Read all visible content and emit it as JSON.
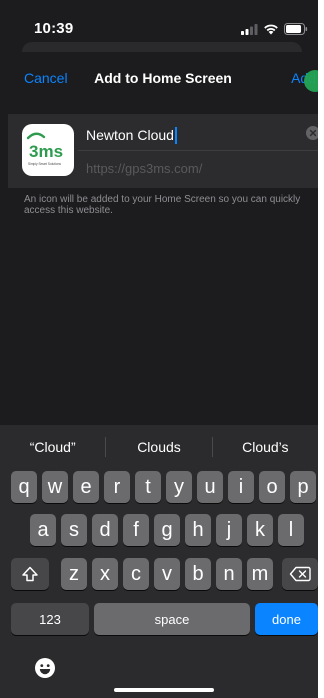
{
  "status_bar": {
    "time": "10:39"
  },
  "nav": {
    "cancel_label": "Cancel",
    "title": "Add to Home Screen",
    "add_label": "Add"
  },
  "shortcut": {
    "icon_text": "3ms",
    "icon_tagline": "Simply Smart Solutions",
    "name_value": "Newton Cloud",
    "url": "https://gps3ms.com/",
    "info": "An icon will be added to your Home Screen so you can quickly access this website."
  },
  "keyboard": {
    "suggestions": [
      "“Cloud”",
      "Clouds",
      "Cloud’s"
    ],
    "row1": [
      "q",
      "w",
      "e",
      "r",
      "t",
      "y",
      "u",
      "i",
      "o",
      "p"
    ],
    "row2": [
      "a",
      "s",
      "d",
      "f",
      "g",
      "h",
      "j",
      "k",
      "l"
    ],
    "row3": [
      "z",
      "x",
      "c",
      "v",
      "b",
      "n",
      "m"
    ],
    "numbers_label": "123",
    "space_label": "space",
    "done_label": "done"
  },
  "colors": {
    "accent": "#0a84ff",
    "background": "#1c1c1e",
    "card": "#2c2c2e",
    "key": "#6b6b6e",
    "touch_indicator": "#23a455"
  },
  "icons": [
    "signal-icon",
    "wifi-icon",
    "battery-icon",
    "clear-icon",
    "shift-icon",
    "backspace-icon",
    "emoji-icon"
  ]
}
